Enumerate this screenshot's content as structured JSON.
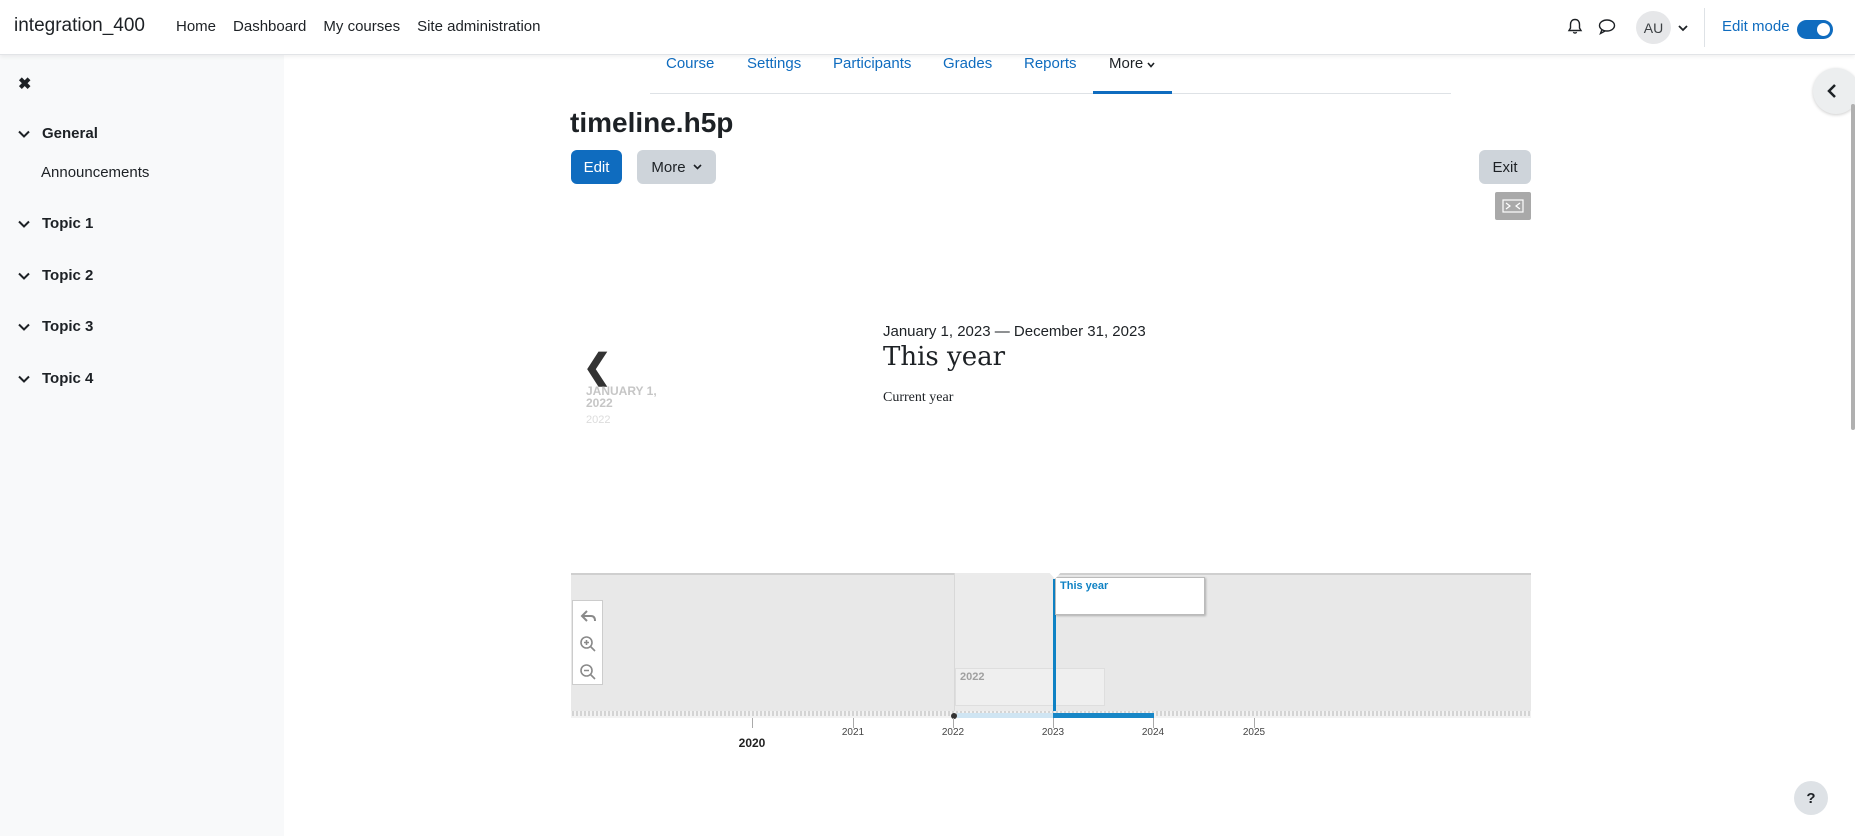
{
  "navbar": {
    "brand": "integration_400",
    "links": [
      "Home",
      "Dashboard",
      "My courses",
      "Site administration"
    ],
    "avatar_initials": "AU",
    "edit_mode_label": "Edit mode",
    "edit_mode_on": true
  },
  "drawer": {
    "sections": [
      {
        "label": "General",
        "items": [
          "Announcements"
        ]
      },
      {
        "label": "Topic 1"
      },
      {
        "label": "Topic 2"
      },
      {
        "label": "Topic 3"
      },
      {
        "label": "Topic 4"
      }
    ]
  },
  "secondary_nav": {
    "tabs": [
      "Course",
      "Settings",
      "Participants",
      "Grades",
      "Reports",
      "More"
    ],
    "active": "More"
  },
  "page": {
    "title": "timeline.h5p",
    "edit_button": "Edit",
    "more_button": "More",
    "exit_button": "Exit"
  },
  "timeline": {
    "prev_slide": {
      "date": "JANUARY 1, 2022",
      "year": "2022"
    },
    "current_slide": {
      "date": "January 1, 2023 — December 31, 2023",
      "headline": "This year",
      "text": "Current year"
    },
    "markers": {
      "previous": "2022",
      "current": "This year"
    },
    "axis": {
      "major": "2020",
      "years": [
        "2021",
        "2022",
        "2023",
        "2024",
        "2025"
      ]
    }
  },
  "help_label": "?",
  "colors": {
    "primary": "#0f6cbf",
    "timeline_accent": "#1887c7"
  }
}
